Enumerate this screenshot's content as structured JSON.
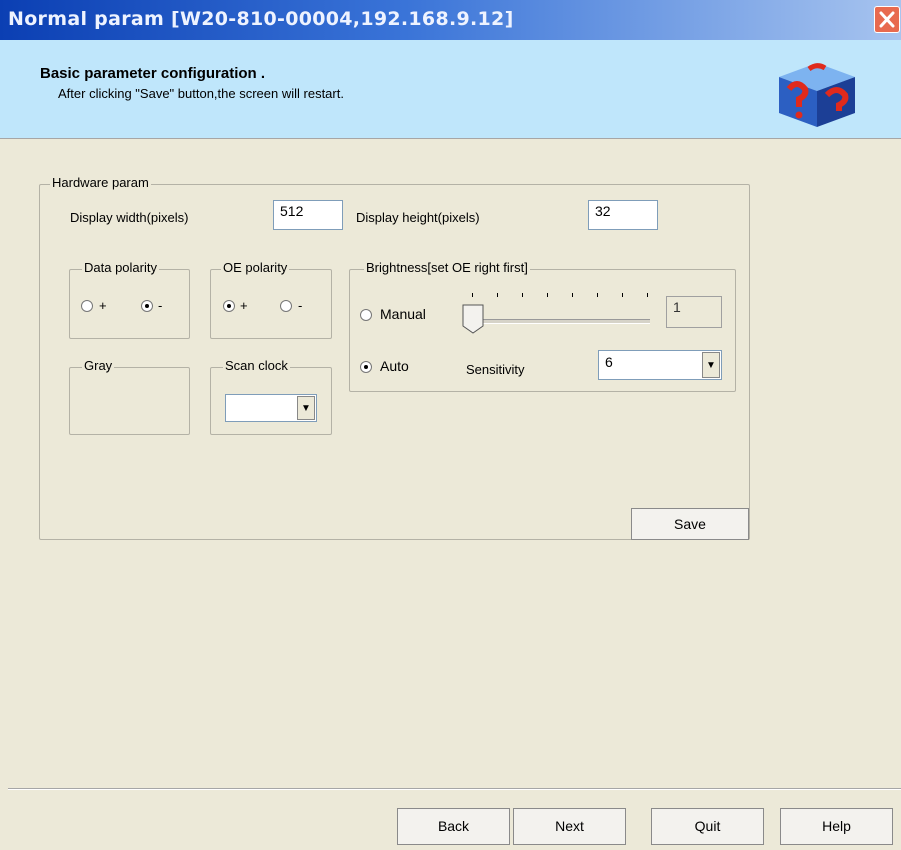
{
  "window": {
    "title": "Normal param [W20-810-00004,192.168.9.12]"
  },
  "header": {
    "title": "Basic parameter configuration .",
    "subtitle": "After clicking \"Save\" button,the screen will restart.",
    "logo_icon": "help-cube-icon"
  },
  "hardware": {
    "group_label": "Hardware param",
    "width_label": "Display width(pixels)",
    "width_value": "512",
    "height_label": "Display height(pixels)",
    "height_value": "32",
    "data_polarity": {
      "label": "Data polarity",
      "plus": "+",
      "minus": "-",
      "selected": "minus"
    },
    "oe_polarity": {
      "label": "OE polarity",
      "plus": "+",
      "minus": "-",
      "selected": "plus"
    },
    "gray": {
      "label": "Gray"
    },
    "scan_clock": {
      "label": "Scan clock",
      "value": ""
    },
    "brightness": {
      "label": "Brightness[set OE right first]",
      "manual_label": "Manual",
      "auto_label": "Auto",
      "selected": "auto",
      "manual_value": "1",
      "slider_position_fraction": 0.0,
      "sensitivity_label": "Sensitivity",
      "sensitivity_value": "6"
    },
    "save_label": "Save"
  },
  "footer": {
    "back_label": "Back",
    "next_label": "Next",
    "quit_label": "Quit",
    "help_label": "Help"
  },
  "colors": {
    "title_bar": "#0b3fb3",
    "header_bg": "#bfe6fb",
    "dialog_bg": "#ece9d8",
    "close_button": "#e86a4f"
  }
}
